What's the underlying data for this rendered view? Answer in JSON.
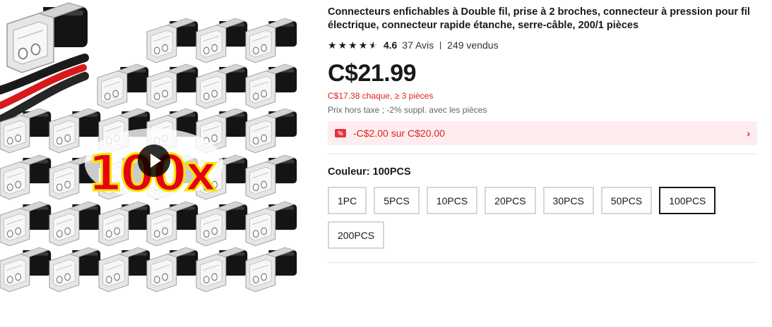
{
  "product": {
    "title": "Connecteurs enfichables à Double fil, prise à 2 broches, connecteur à pression pour fil électrique, connecteur rapide étanche, serre-câble, 200/1 pièces",
    "image_badge": "100x",
    "rating": "4.6",
    "rating_stars": 4.6,
    "reviews": "37 Avis",
    "sold": "249 vendus",
    "price": "C$21.99",
    "bulk_price": "C$17.38 chaque, ≥ 3 pièces",
    "tax_note": "Prix hors taxe ; -2% suppl. avec les pièces",
    "coupon": {
      "icon": "coupon-icon",
      "text": "-C$2.00 sur C$20.00"
    },
    "color_label": "Couleur: 100PCS",
    "options": [
      {
        "label": "1PC",
        "selected": false
      },
      {
        "label": "5PCS",
        "selected": false
      },
      {
        "label": "10PCS",
        "selected": false
      },
      {
        "label": "20PCS",
        "selected": false
      },
      {
        "label": "30PCS",
        "selected": false
      },
      {
        "label": "50PCS",
        "selected": false
      },
      {
        "label": "100PCS",
        "selected": true
      },
      {
        "label": "200PCS",
        "selected": false
      }
    ]
  },
  "colors": {
    "accent_red": "#e02020",
    "coupon_bg": "#fdedef",
    "selected_border": "#191919",
    "badge_red": "#e60012",
    "badge_outline": "#f5e600"
  }
}
